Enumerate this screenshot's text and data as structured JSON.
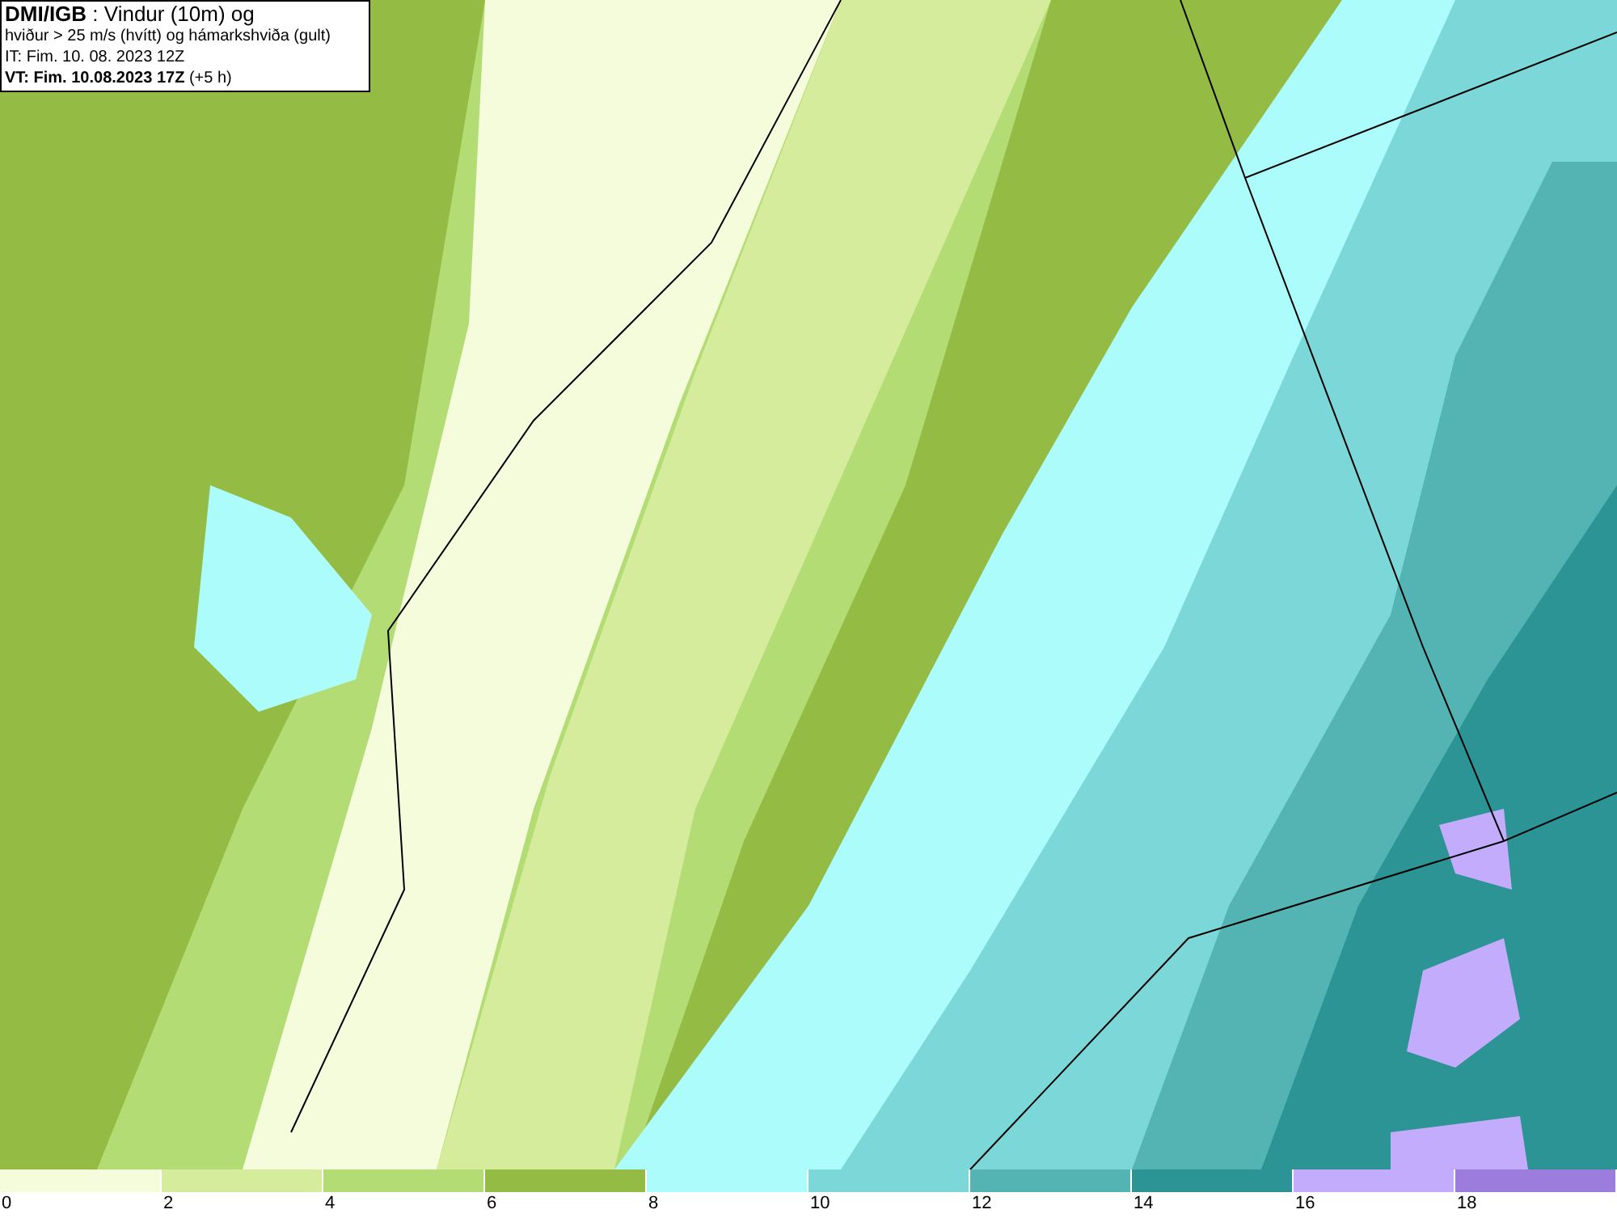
{
  "title_box": {
    "lines": [
      "**DMI/IGB** : Vindur (10m) og",
      "hviður > 25 m/s (hvítt) og hámarkshviða (gult)",
      "IT: Fim. 10. 08. 2023 12Z",
      "**VT: Fim. 10.08.2023 17Z** (+5 h)"
    ]
  },
  "legend": [
    {
      "label": "0",
      "color": "#f4fcdc"
    },
    {
      "label": "2",
      "color": "#d4ec9c"
    },
    {
      "label": "4",
      "color": "#b4dc74"
    },
    {
      "label": "6",
      "color": "#94bc44"
    },
    {
      "label": "8",
      "color": "#acfcfc"
    },
    {
      "label": "10",
      "color": "#7cd8d8"
    },
    {
      "label": "12",
      "color": "#54b4b4"
    },
    {
      "label": "14",
      "color": "#2c9494"
    },
    {
      "label": "16",
      "color": "#c4acfc"
    },
    {
      "label": "18",
      "color": "#9c7cdc"
    }
  ]
}
